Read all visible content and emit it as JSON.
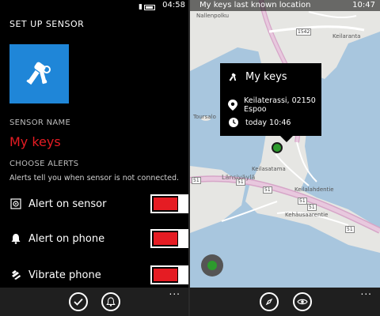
{
  "left": {
    "status": {
      "time": "04:58"
    },
    "page_title": "SET UP SENSOR",
    "sensor_name_label": "SENSOR NAME",
    "sensor_name": "My keys",
    "choose_alerts_label": "CHOOSE ALERTS",
    "hint": "Alerts tell you when sensor is not connected.",
    "alerts": [
      {
        "label": "Alert on sensor",
        "on": true
      },
      {
        "label": "Alert on phone",
        "on": true
      },
      {
        "label": "Vibrate phone",
        "on": true
      }
    ],
    "appbar": {
      "more": "..."
    }
  },
  "right": {
    "status": {
      "title": "My keys last known location",
      "time": "10:47"
    },
    "popup": {
      "title": "My keys",
      "address": "Keilaterassi, 02150 Espoo",
      "time": "today 10:46"
    },
    "map_labels": {
      "street1": "Nallenpolku",
      "street2": "Keilaranta",
      "street3": "Länsiväylä",
      "street4": "Keilalahdentie",
      "street5": "Keilasatama",
      "street6": "Kehäusaarentie",
      "area": "Toursalo",
      "road1": "51",
      "road2": "51",
      "road3": "51",
      "road4": "51",
      "road5": "51",
      "road6": "51",
      "road7": "1542"
    },
    "appbar": {
      "more": "..."
    }
  },
  "colors": {
    "accent_red": "#e51c23",
    "tile_blue": "#1f86d8",
    "pin_green": "#2d9b2d",
    "water": "#a8c6de",
    "land": "#e6e6e3"
  }
}
